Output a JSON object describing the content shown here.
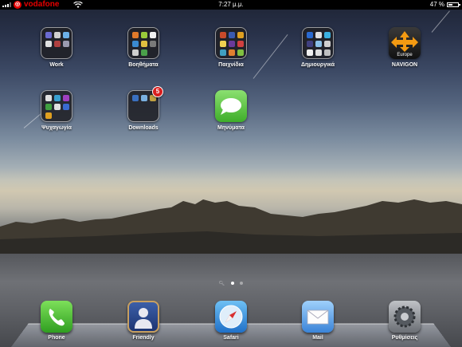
{
  "status_bar": {
    "carrier": "vodafone",
    "carrier_logo_glyph": "◎",
    "time": "7:27 μ.μ.",
    "battery_percent": "47 %",
    "battery_level": 0.47,
    "icons": [
      "signal-bars-icon",
      "vodafone-logo-icon",
      "wifi-icon",
      "battery-icon"
    ]
  },
  "apps": [
    {
      "label": "Work",
      "kind": "folder",
      "icon": "folder-icon"
    },
    {
      "label": "Βοηθήματα",
      "kind": "folder",
      "icon": "folder-icon"
    },
    {
      "label": "Παιχνίδια",
      "kind": "folder",
      "icon": "folder-icon"
    },
    {
      "label": "Δημιουργικά",
      "kind": "folder",
      "icon": "folder-icon"
    },
    {
      "label": "NAVIGON",
      "kind": "app",
      "icon": "navigon-icon",
      "sub_label": "Europe"
    },
    {
      "label": "Ψυχαγωγία",
      "kind": "folder",
      "icon": "folder-icon"
    },
    {
      "label": "Downloads",
      "kind": "folder",
      "icon": "folder-icon",
      "badge": "5"
    },
    {
      "label": "Μηνύματα",
      "kind": "app",
      "icon": "messages-icon"
    }
  ],
  "page_indicator": {
    "pages": 2,
    "current": 1,
    "has_search_page": true
  },
  "dock": [
    {
      "label": "Phone",
      "icon": "phone-icon"
    },
    {
      "label": "Friendly",
      "icon": "friendly-icon"
    },
    {
      "label": "Safari",
      "icon": "safari-icon"
    },
    {
      "label": "Mail",
      "icon": "mail-icon"
    },
    {
      "label": "Ρυθμίσεις",
      "icon": "settings-icon"
    }
  ],
  "colors": {
    "badge": "#d81e1e",
    "carrier_red": "#e60000",
    "navigon_orange": "#f39a12",
    "messages_green": "#4ec33a",
    "phone_green": "#3db52a",
    "safari_blue": "#2a86d8",
    "mail_blue": "#4a8fe0"
  }
}
